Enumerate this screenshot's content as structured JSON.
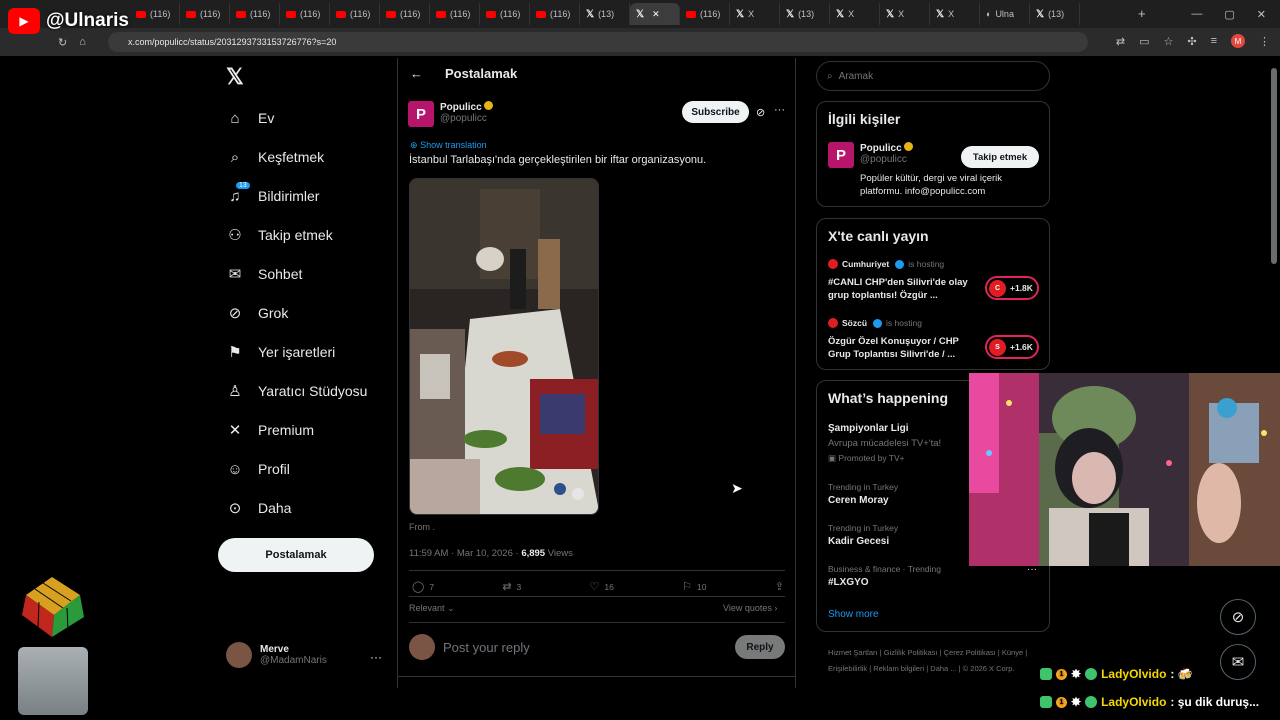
{
  "overlay": {
    "channel_handle": "@Ulnaris"
  },
  "browser": {
    "tabs": [
      {
        "kind": "yt",
        "label": "(116)"
      },
      {
        "kind": "yt",
        "label": "(116)"
      },
      {
        "kind": "yt",
        "label": "(116)"
      },
      {
        "kind": "yt",
        "label": "(116)"
      },
      {
        "kind": "yt",
        "label": "(116)"
      },
      {
        "kind": "yt",
        "label": "(116)"
      },
      {
        "kind": "yt",
        "label": "(116)"
      },
      {
        "kind": "yt",
        "label": "(116)"
      },
      {
        "kind": "yt",
        "label": "(116)"
      },
      {
        "kind": "x",
        "label": "(13)"
      },
      {
        "kind": "x",
        "label": "",
        "active": true
      },
      {
        "kind": "yt",
        "label": "(116)"
      },
      {
        "kind": "x",
        "label": "X"
      },
      {
        "kind": "x",
        "label": "(13)"
      },
      {
        "kind": "x",
        "label": "X"
      },
      {
        "kind": "x",
        "label": "X"
      },
      {
        "kind": "x",
        "label": "X"
      },
      {
        "kind": "web",
        "label": "Ulna"
      },
      {
        "kind": "x",
        "label": "(13)"
      }
    ],
    "url": "x.com/populicc/status/2031293733153726776?s=20",
    "profile_initial": "M"
  },
  "leftnav": {
    "items": [
      {
        "label": "Ev",
        "icon": "home-icon",
        "glyph": "⌂"
      },
      {
        "label": "Keşfetmek",
        "icon": "search-icon",
        "glyph": "⌕"
      },
      {
        "label": "Bildirimler",
        "icon": "bell-icon",
        "glyph": "♫",
        "badge": "13"
      },
      {
        "label": "Takip etmek",
        "icon": "follow-icon",
        "glyph": "⚇"
      },
      {
        "label": "Sohbet",
        "icon": "mail-icon",
        "glyph": "✉"
      },
      {
        "label": "Grok",
        "icon": "grok-icon",
        "glyph": "⊘"
      },
      {
        "label": "Yer işaretleri",
        "icon": "bookmark-icon",
        "glyph": "⚑"
      },
      {
        "label": "Yaratıcı Stüdyosu",
        "icon": "studio-icon",
        "glyph": "♙"
      },
      {
        "label": "Premium",
        "icon": "x-premium-icon",
        "glyph": "✕"
      },
      {
        "label": "Profil",
        "icon": "profile-icon",
        "glyph": "☺"
      },
      {
        "label": "Daha",
        "icon": "more-circle-icon",
        "glyph": "⊙"
      }
    ],
    "post_button": "Postalamak",
    "user_name": "Merve",
    "user_handle": "@MadamNaris"
  },
  "main": {
    "header_title": "Postalamak",
    "author_name": "Populicc",
    "author_handle": "@populicc",
    "subscribe": "Subscribe",
    "show_translation": "Show translation",
    "text": "İstanbul Tarlabaşı'nda gerçekleştirilen bir iftar organizasyonu.",
    "from_label": "From .",
    "timestamp": "11:59 AM · Mar 10, 2026 · ",
    "views_count": "6,895",
    "views_label": " Views",
    "actions": {
      "replies": "7",
      "reposts": "3",
      "likes": "16",
      "bookmarks": "10"
    },
    "relevant": "Relevant",
    "view_quotes": "View quotes",
    "reply_placeholder": "Post your reply",
    "reply_button": "Reply"
  },
  "right": {
    "search_placeholder": "Aramak",
    "related": {
      "title": "İlgili kişiler",
      "name": "Populicc",
      "handle": "@populicc",
      "follow": "Takip etmek",
      "bio": "Popüler kültür, dergi ve viral içerik platformu. info@populicc.com"
    },
    "live": {
      "title": "X'te canlı yayın",
      "spaces": [
        {
          "host": "Cumhuriyet",
          "hosting": "is hosting",
          "title": "#CANLI CHP'den Silivri'de olay grup toplantısı! Özgür ...",
          "listeners": "+1.8K"
        },
        {
          "host": "Sözcü",
          "hosting": "is hosting",
          "title": "Özgür Özel Konuşuyor / CHP Grup Toplantısı Silivri'de / ...",
          "listeners": "+1.6K"
        }
      ]
    },
    "happening": {
      "title": "What’s happening",
      "promo_title": "Şampiyonlar Ligi",
      "promo_sub": "Avrupa mücadelesi TV+'ta!",
      "promo_by": "Promoted by TV+",
      "trends": [
        {
          "context": "Trending in Turkey",
          "name": "Ceren Moray"
        },
        {
          "context": "Trending in Turkey",
          "name": "Kadir Gecesi"
        },
        {
          "context": "Business & finance · Trending",
          "name": "#LXGYO"
        }
      ],
      "show_more": "Show more"
    },
    "footer": [
      "Hizmet Şartları",
      "Gizlilik Politikası",
      "Çerez Politikası",
      "Künye",
      "Erişilebilirlik",
      "Reklam bilgileri",
      "Daha ...",
      "© 2026 X Corp."
    ]
  },
  "chat": [
    {
      "user": "LadyOlvido",
      "message": ": 🍻"
    },
    {
      "user": "LadyOlvido",
      "message": ": şu dik duruş..."
    }
  ],
  "colors": {
    "accent": "#1d9bf0",
    "brand": "#b7156b",
    "verified": "#e7b416",
    "live": "#e11d24"
  }
}
